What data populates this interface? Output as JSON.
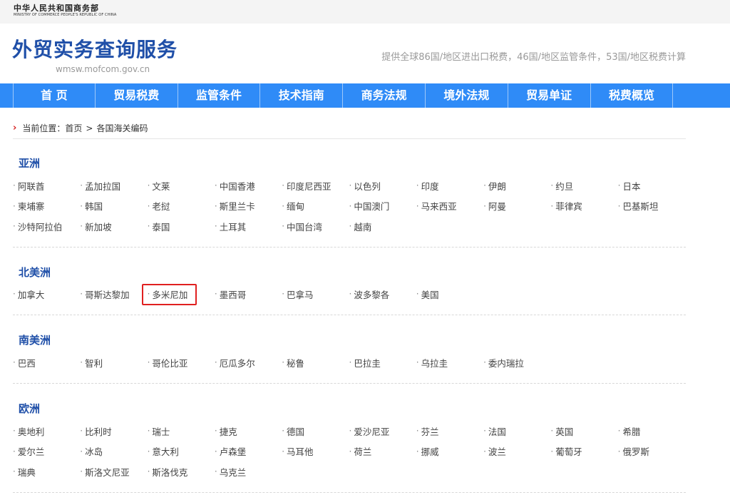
{
  "ministry": {
    "cn": "中华人民共和国商务部",
    "en": "MINISTRY OF COMMERCE PEOPLE'S REPUBLIC OF CHINA"
  },
  "site": {
    "title": "外贸实务查询服务",
    "domain": "wmsw.mofcom.gov.cn",
    "slogan": "提供全球86国/地区进出口税费，46国/地区监管条件，53国/地区税费计算"
  },
  "nav": [
    "首 页",
    "贸易税费",
    "监管条件",
    "技术指南",
    "商务法规",
    "境外法规",
    "贸易单证",
    "税费概览"
  ],
  "breadcrumb": {
    "prefix": "当前位置：",
    "home": "首页",
    "sep": ">",
    "current": "各国海关编码"
  },
  "regions": [
    {
      "name": "亚洲",
      "countries": [
        "阿联酋",
        "孟加拉国",
        "文莱",
        "中国香港",
        "印度尼西亚",
        "以色列",
        "印度",
        "伊朗",
        "约旦",
        "日本",
        "柬埔寨",
        "韩国",
        "老挝",
        "斯里兰卡",
        "缅甸",
        "中国澳门",
        "马来西亚",
        "阿曼",
        "菲律宾",
        "巴基斯坦",
        "沙特阿拉伯",
        "新加坡",
        "泰国",
        "土耳其",
        "中国台湾",
        "越南"
      ]
    },
    {
      "name": "北美洲",
      "countries": [
        "加拿大",
        "哥斯达黎加",
        "多米尼加",
        "墨西哥",
        "巴拿马",
        "波多黎各",
        "美国"
      ]
    },
    {
      "name": "南美洲",
      "countries": [
        "巴西",
        "智利",
        "哥伦比亚",
        "厄瓜多尔",
        "秘鲁",
        "巴拉圭",
        "乌拉圭",
        "委内瑞拉"
      ]
    },
    {
      "name": "欧洲",
      "countries": [
        "奥地利",
        "比利时",
        "瑞士",
        "捷克",
        "德国",
        "爱沙尼亚",
        "芬兰",
        "法国",
        "英国",
        "希腊",
        "爱尔兰",
        "冰岛",
        "意大利",
        "卢森堡",
        "马耳他",
        "荷兰",
        "挪威",
        "波兰",
        "葡萄牙",
        "俄罗斯",
        "瑞典",
        "斯洛文尼亚",
        "斯洛伐克",
        "乌克兰"
      ]
    }
  ],
  "dot": "·",
  "colors": {
    "nav_bg": "#2f8bf7",
    "title_blue": "#1f4fa8",
    "highlight": "#e02020"
  }
}
